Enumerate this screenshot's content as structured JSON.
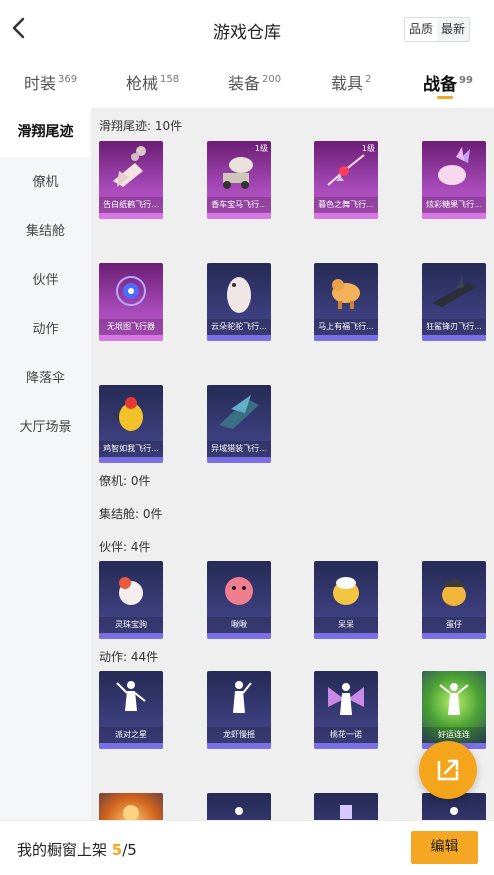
{
  "header": {
    "title": "游戏仓库",
    "toggle": [
      "品质",
      "最新"
    ]
  },
  "tabs": [
    {
      "label": "时装",
      "count": "369"
    },
    {
      "label": "枪械",
      "count": "158"
    },
    {
      "label": "装备",
      "count": "200"
    },
    {
      "label": "载具",
      "count": "2"
    },
    {
      "label": "战备",
      "count": "99"
    }
  ],
  "sidebar": [
    "滑翔尾迹",
    "僚机",
    "集结舱",
    "伙伴",
    "动作",
    "降落伞",
    "大厅场景"
  ],
  "sections": {
    "glide": {
      "title": "滑翔尾迹: 10件",
      "items": [
        {
          "label": "告白纸鹤飞行...",
          "level": ""
        },
        {
          "label": "香车宝马飞行...",
          "level": "1级"
        },
        {
          "label": "暮色之舞飞行...",
          "level": "1级"
        },
        {
          "label": "炫彩糖果飞行...",
          "level": ""
        },
        {
          "label": "无垠图飞行器",
          "level": ""
        },
        {
          "label": "云朵驼驼飞行...",
          "level": ""
        },
        {
          "label": "马上有福飞行...",
          "level": ""
        },
        {
          "label": "狂鲨锋刃飞行...",
          "level": ""
        },
        {
          "label": "鸡智如我飞行...",
          "level": ""
        },
        {
          "label": "异域猎装飞行...",
          "level": ""
        }
      ]
    },
    "wingman": {
      "title": "僚机: 0件"
    },
    "pod": {
      "title": "集结舱: 0件"
    },
    "partner": {
      "title": "伙伴: 4件",
      "items": [
        {
          "label": "灵珠宝驹"
        },
        {
          "label": "啾啾"
        },
        {
          "label": "呆呆"
        },
        {
          "label": "蛋仔"
        }
      ]
    },
    "emote": {
      "title": "动作: 44件",
      "items": [
        {
          "label": "派对之星"
        },
        {
          "label": "龙虾慢摇"
        },
        {
          "label": "桃花一诺"
        },
        {
          "label": "好运连连"
        }
      ]
    }
  },
  "footer": {
    "text": "我的橱窗上架",
    "current": "5",
    "total": "/5",
    "edit": "编辑"
  },
  "colors": {
    "accent": "#f5a623",
    "pink_card": "#a74ab9",
    "purple_card": "#3a3d79"
  },
  "icons": {
    "back": "chevron-left-icon",
    "fab": "share-external-icon"
  }
}
